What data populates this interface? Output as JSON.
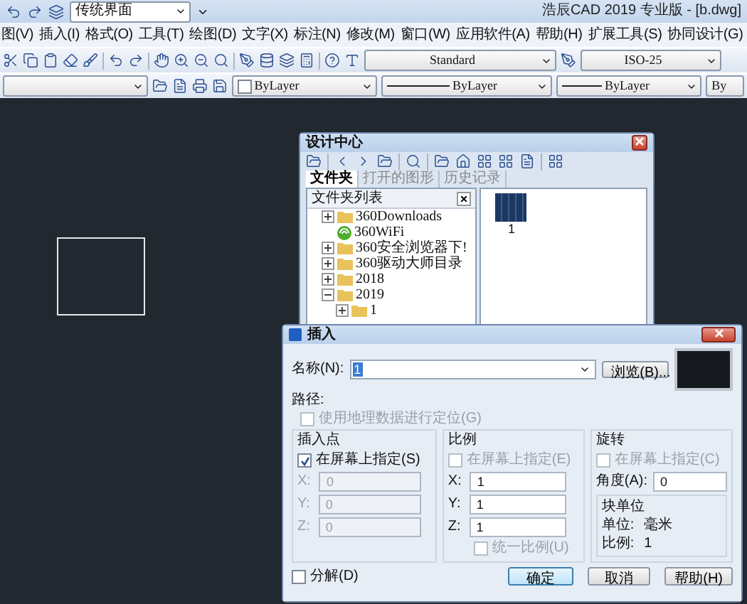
{
  "title_bar": {
    "workspace": "传统界面",
    "title": "浩辰CAD 2019 专业版 - [b.dwg]"
  },
  "menu": [
    {
      "label": "图(V)"
    },
    {
      "label": "插入(I)"
    },
    {
      "label": "格式(O)"
    },
    {
      "label": "工具(T)"
    },
    {
      "label": "绘图(D)"
    },
    {
      "label": "文字(X)"
    },
    {
      "label": "标注(N)"
    },
    {
      "label": "修改(M)"
    },
    {
      "label": "窗口(W)"
    },
    {
      "label": "应用软件(A)"
    },
    {
      "label": "帮助(H)"
    },
    {
      "label": "扩展工具(S)"
    },
    {
      "label": "协同设计(G)"
    }
  ],
  "toolbar": {
    "text_style": "Standard",
    "dim_style": "ISO-25"
  },
  "properties_bar": {
    "color_setting": "ByLayer",
    "linetype": "ByLayer",
    "lineweight": "ByLayer",
    "plot_style": "By"
  },
  "design_center": {
    "title": "设计中心",
    "tabs": [
      {
        "label": "文件夹",
        "selected": true
      },
      {
        "label": "打开的图形",
        "selected": false
      },
      {
        "label": "历史记录",
        "selected": false
      }
    ],
    "folder_list": {
      "title": "文件夹列表",
      "close": "×",
      "items": [
        {
          "label": "360Downloads",
          "kind": "folder",
          "expanded": false
        },
        {
          "label": "360WiFi",
          "kind": "app"
        },
        {
          "label": "360安全浏览器下!",
          "kind": "folder",
          "expanded": false
        },
        {
          "label": "360驱动大师目录",
          "kind": "folder",
          "expanded": false
        },
        {
          "label": "2018",
          "kind": "folder",
          "expanded": false
        },
        {
          "label": "2019",
          "kind": "folder",
          "expanded": true,
          "children": [
            {
              "label": "1",
              "kind": "folder",
              "expanded": false
            }
          ]
        }
      ]
    },
    "preview": {
      "label": "1"
    }
  },
  "insert_dialog": {
    "title": "插入",
    "name": {
      "label": "名称(N):",
      "value": "1"
    },
    "browse": "浏览(B)...",
    "path_label": "路径:",
    "geo": {
      "label": "使用地理数据进行定位(G)",
      "checked": false,
      "disabled": true
    },
    "insertion_point": {
      "title": "插入点",
      "on_screen": {
        "label": "在屏幕上指定(S)",
        "checked": true
      },
      "fields": [
        {
          "label": "X:",
          "value": "0",
          "disabled": true
        },
        {
          "label": "Y:",
          "value": "0",
          "disabled": true
        },
        {
          "label": "Z:",
          "value": "0",
          "disabled": true
        }
      ]
    },
    "scale": {
      "title": "比例",
      "on_screen": {
        "label": "在屏幕上指定(E)",
        "checked": false
      },
      "fields": [
        {
          "label": "X:",
          "value": "1",
          "disabled": false
        },
        {
          "label": "Y:",
          "value": "1",
          "disabled": false
        },
        {
          "label": "Z:",
          "value": "1",
          "disabled": false
        }
      ],
      "uniform": {
        "label": "统一比例(U)",
        "checked": false
      }
    },
    "rotation": {
      "title": "旋转",
      "on_screen": {
        "label": "在屏幕上指定(C)",
        "checked": false
      },
      "angle": {
        "label": "角度(A):",
        "value": "0"
      }
    },
    "block_unit": {
      "title": "块单位",
      "unit_label": "单位:",
      "unit": "毫米",
      "factor_label": "比例:",
      "factor": "1"
    },
    "explode": {
      "label": "分解(D)",
      "checked": false
    },
    "buttons": [
      {
        "label": "确定",
        "kind": "default"
      },
      {
        "label": "取消",
        "kind": "normal"
      },
      {
        "label": "帮助(H)",
        "kind": "normal"
      }
    ]
  }
}
